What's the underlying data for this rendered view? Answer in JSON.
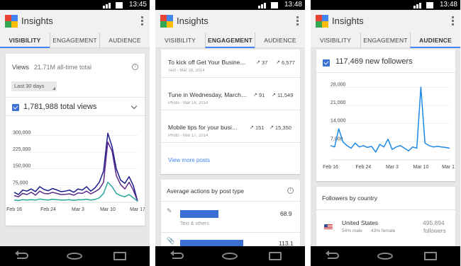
{
  "screens": [
    {
      "status": {
        "time": "13:45"
      },
      "app_title": "Insights",
      "tabs": [
        "VISIBILITY",
        "ENGAGEMENT",
        "AUDIENCE"
      ],
      "active_tab": "VISIBILITY",
      "views": {
        "label": "Views",
        "total": "21.71M all-time total",
        "range": "Last 30 days",
        "metric": "1,781,988 total views"
      }
    },
    {
      "status": {
        "time": "13:48"
      },
      "app_title": "Insights",
      "tabs": [
        "VISIBILITY",
        "ENGAGEMENT",
        "AUDIENCE"
      ],
      "active_tab": "ENGAGEMENT",
      "posts": [
        {
          "title": "To kick off Get Your Busine…",
          "meta": "Text - Mar 18, 2014",
          "shares": "37",
          "views": "6,577"
        },
        {
          "title": "Tune in Wednesday, March…",
          "meta": "Photo - Mar 18, 2014",
          "shares": "91",
          "views": "11,549"
        },
        {
          "title": "Mobile tips for your busi…",
          "meta": "Photo - Mar 17, 2014",
          "shares": "151",
          "views": "15,350"
        }
      ],
      "view_more": "View more posts",
      "actions": {
        "title": "Average actions by post type",
        "rows": [
          {
            "value": "68.9",
            "label": "Text & others",
            "fraction": 0.47
          },
          {
            "value": "113.1",
            "label": "",
            "fraction": 0.77
          }
        ]
      }
    },
    {
      "status": {
        "time": "13:48"
      },
      "app_title": "Insights",
      "tabs": [
        "VISIBILITY",
        "ENGAGEMENT",
        "AUDIENCE"
      ],
      "active_tab": "AUDIENCE",
      "followers": {
        "metric": "117,469 new followers"
      },
      "country": {
        "title": "Followers by country",
        "name": "United States",
        "male": "54% male",
        "female": "43% female",
        "count": "495,894",
        "unit": "followers"
      }
    }
  ],
  "colors": {
    "accent": "#4285f4",
    "check": "#3b6fd4",
    "line_blue": "#1e88e5",
    "line_purple": "#5b2a8c",
    "line_teal": "#26a69a",
    "line_navy": "#1a1a8c"
  },
  "chart_data": [
    {
      "type": "line",
      "x": [
        "Feb 16",
        "Feb 17",
        "Feb 18",
        "Feb 19",
        "Feb 20",
        "Feb 21",
        "Feb 22",
        "Feb 23",
        "Feb 24",
        "Feb 25",
        "Feb 26",
        "Feb 27",
        "Feb 28",
        "Mar 1",
        "Mar 2",
        "Mar 3",
        "Mar 4",
        "Mar 5",
        "Mar 6",
        "Mar 7",
        "Mar 8",
        "Mar 9",
        "Mar 10",
        "Mar 11",
        "Mar 12",
        "Mar 13",
        "Mar 14",
        "Mar 15",
        "Mar 16",
        "Mar 17"
      ],
      "x_ticks": [
        "Feb 16",
        "Feb 24",
        "Mar 3",
        "Mar 10",
        "Mar 17"
      ],
      "y_ticks": [
        "75,000",
        "150,000",
        "225,000",
        "300,000"
      ],
      "ylim": [
        0,
        330000
      ],
      "series": [
        {
          "color": "#1a1a8c",
          "values": [
            45000,
            35000,
            55000,
            50000,
            60000,
            48000,
            70000,
            58000,
            52000,
            62000,
            56000,
            48000,
            50000,
            55000,
            45000,
            60000,
            55000,
            70000,
            50000,
            65000,
            90000,
            140000,
            310000,
            250000,
            150000,
            100000,
            85000,
            115000,
            75000,
            5000
          ]
        },
        {
          "color": "#5b2a8c",
          "values": [
            30000,
            25000,
            40000,
            35000,
            45000,
            32000,
            50000,
            40000,
            38000,
            45000,
            40000,
            35000,
            36000,
            38000,
            32000,
            42000,
            40000,
            50000,
            38000,
            48000,
            60000,
            90000,
            270000,
            230000,
            120000,
            80000,
            60000,
            90000,
            55000,
            5000
          ]
        },
        {
          "color": "#26a69a",
          "values": [
            10000,
            8000,
            12000,
            10000,
            12000,
            10000,
            15000,
            12000,
            10000,
            14000,
            12000,
            10000,
            10000,
            12000,
            9000,
            12000,
            11000,
            14000,
            10000,
            13000,
            20000,
            40000,
            90000,
            70000,
            40000,
            30000,
            25000,
            35000,
            20000,
            5000
          ]
        }
      ]
    },
    {
      "type": "line",
      "x": [
        "Feb 16",
        "Feb 17",
        "Feb 18",
        "Feb 19",
        "Feb 20",
        "Feb 21",
        "Feb 22",
        "Feb 23",
        "Feb 24",
        "Feb 25",
        "Feb 26",
        "Feb 27",
        "Feb 28",
        "Mar 1",
        "Mar 2",
        "Mar 3",
        "Mar 4",
        "Mar 5",
        "Mar 6",
        "Mar 7",
        "Mar 8",
        "Mar 9",
        "Mar 10",
        "Mar 11",
        "Mar 12",
        "Mar 13",
        "Mar 14",
        "Mar 15",
        "Mar 16",
        "Mar 17"
      ],
      "x_ticks": [
        "Feb 16",
        "Feb 24",
        "Mar 3",
        "Mar 10",
        "Mar 17"
      ],
      "y_ticks": [
        "7,000",
        "14,000",
        "21,000",
        "28,000"
      ],
      "ylim": [
        0,
        30000
      ],
      "series": [
        {
          "color": "#1e88e5",
          "values": [
            5500,
            5000,
            12000,
            7000,
            5500,
            4500,
            6500,
            5000,
            5500,
            4800,
            5200,
            3000,
            6000,
            5000,
            8000,
            4000,
            5000,
            5500,
            4500,
            3500,
            5000,
            4500,
            28000,
            6500,
            5500,
            5000,
            5200,
            5000,
            4800,
            4500
          ]
        }
      ]
    }
  ]
}
